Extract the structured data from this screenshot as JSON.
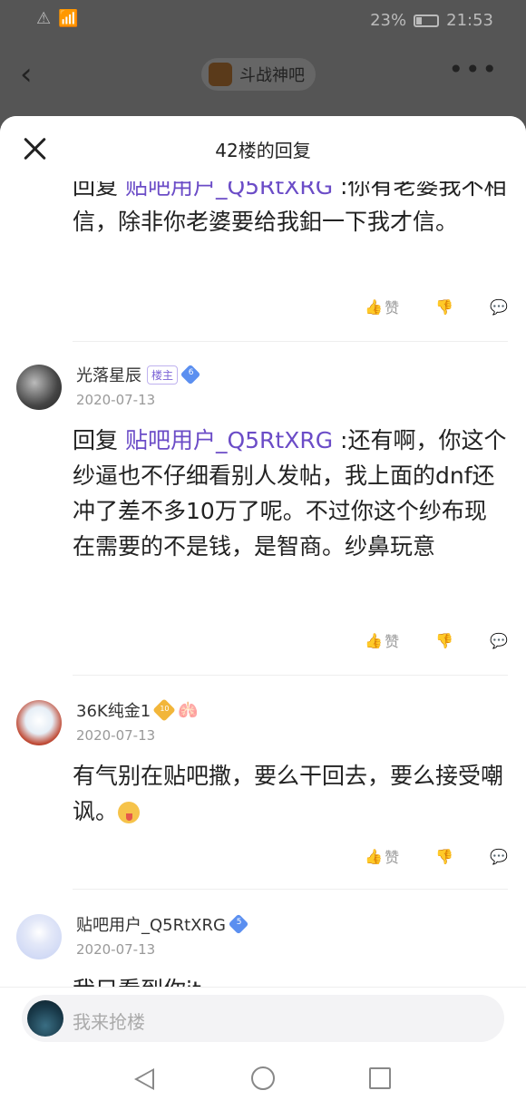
{
  "status": {
    "battery": "23%",
    "time": "21:53"
  },
  "background_nav": {
    "forum_name": "斗战神吧",
    "back": "‹",
    "more": "•••"
  },
  "sheet": {
    "title": "42楼的回复"
  },
  "posts": [
    {
      "body_prefix": "回复 ",
      "mention": "贴吧用户_Q5RtXRG",
      "body_rest": " :你有老婆我不相信，除非你老婆要给我鈤一下我才信。",
      "like_label": "赞"
    },
    {
      "username": "光落星辰",
      "owner_badge": "楼主",
      "level": "6",
      "date": "2020-07-13",
      "body_prefix": "回复 ",
      "mention": "贴吧用户_Q5RtXRG",
      "body_rest": " :还有啊，你这个纱逼也不仔细看别人发帖，我上面的dnf还冲了差不多10万了呢。不过你这个纱布现在需要的不是钱，是智商。纱鼻玩意",
      "like_label": "赞"
    },
    {
      "username": "36K纯金1",
      "level": "10",
      "date": "2020-07-13",
      "body": "有气别在贴吧撒，要么干回去，要么接受嘲讽。",
      "like_label": "赞"
    },
    {
      "username": "贴吧用户_Q5RtXRG",
      "level": "5",
      "date": "2020-07-13",
      "body": "我只看到你it"
    }
  ],
  "input": {
    "placeholder": "我来抢楼"
  },
  "colors": {
    "mention": "#6b4cc7",
    "gem_blue": "#5b8ff0",
    "gem_gold": "#f2b63a"
  }
}
